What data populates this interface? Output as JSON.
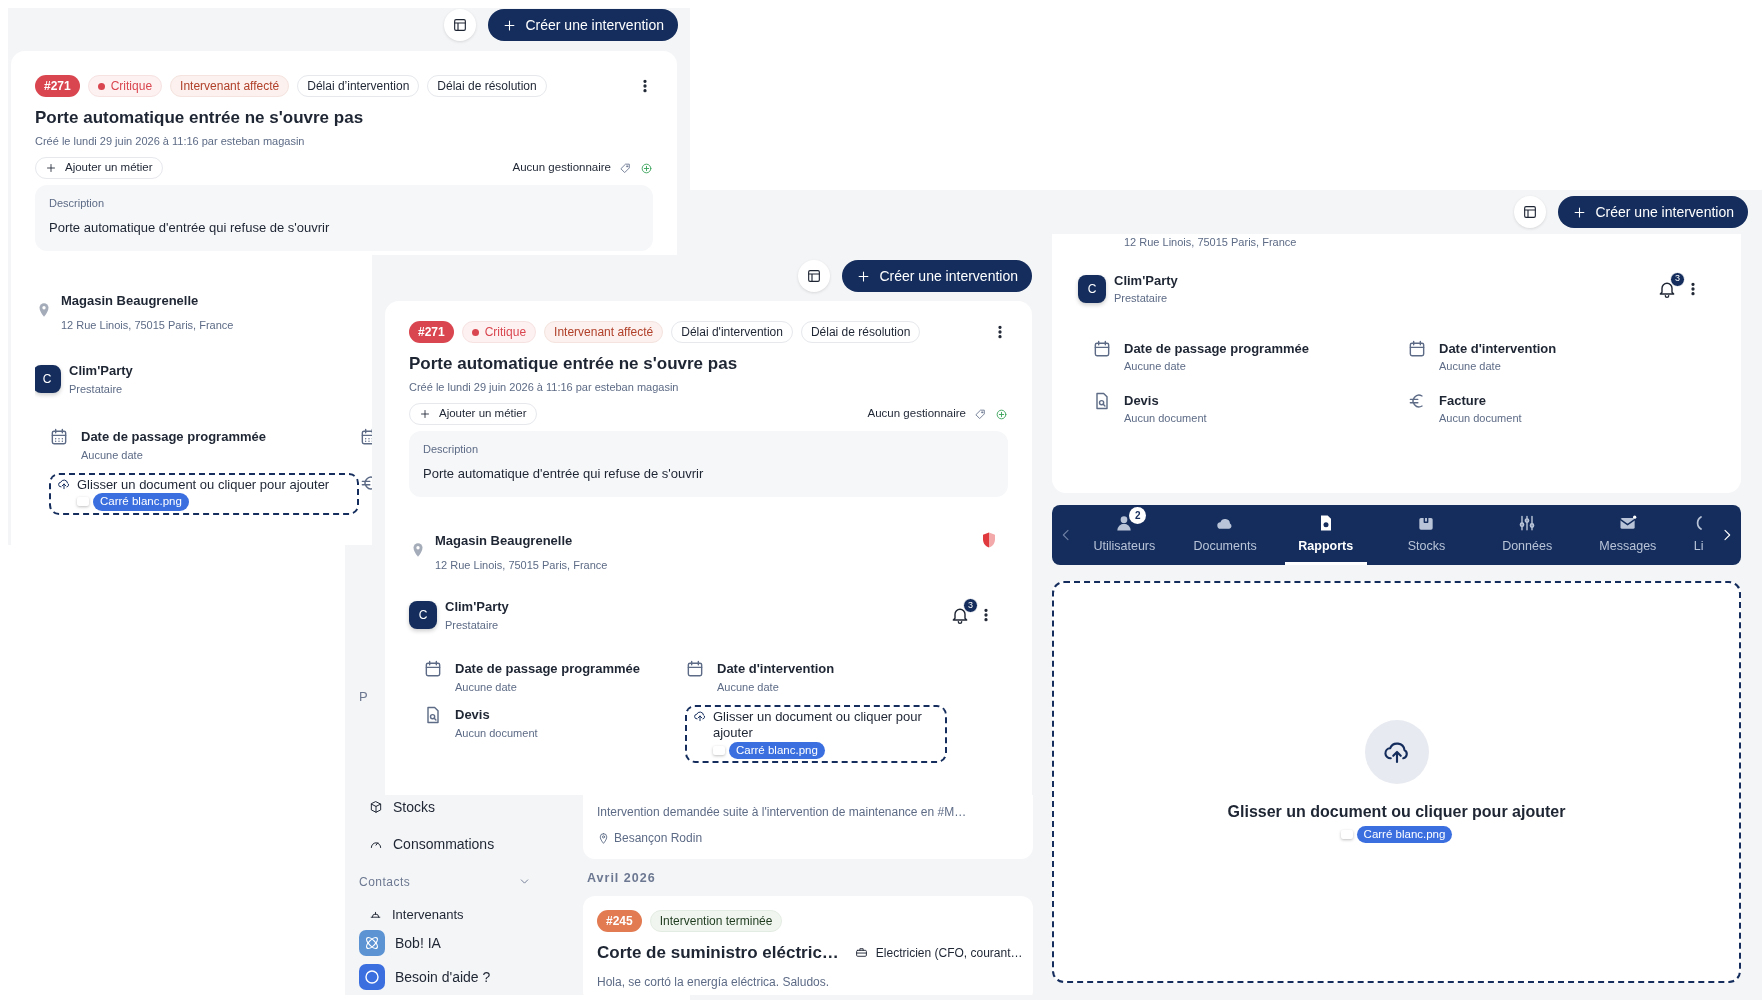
{
  "back_detail_screen": {
    "create_button": "Créer une intervention",
    "badges": [
      {
        "kind": "number",
        "text": "#271",
        "color": "#d9464f"
      },
      {
        "kind": "priority",
        "text": "Critique"
      },
      {
        "kind": "status",
        "text": "Intervenant affecté"
      },
      {
        "kind": "plain",
        "text": "Délai d’intervention"
      },
      {
        "kind": "plain",
        "text": "Délai de résolution"
      }
    ],
    "title": "Porte automatique entrée ne s'ouvre pas",
    "created": "Créé le lundi 29 juin 2026 à 11:16 par esteban magasin",
    "add_trade_button": "Ajouter un métier",
    "manager": "Aucun gestionnaire",
    "description_label": "Description",
    "description": "Porte automatique d'entrée qui refuse de s'ouvrir",
    "site": {
      "name": "Magasin Beaugrenelle",
      "address": "12 Rue Linois, 75015 Paris, France"
    },
    "provider": {
      "initial": "C",
      "name": "Clim'Party",
      "role": "Prestataire"
    },
    "fields": [
      {
        "kind": "date",
        "label": "Date de passage programmée",
        "value": "Aucune date"
      },
      {
        "kind": "date"
      },
      {
        "kind": "dropzone",
        "text": "Glisser un document ou cliquer pour ajouter",
        "dragged_file": "Carré blanc.png"
      },
      {
        "kind": "invoice"
      }
    ]
  },
  "front_detail_screen": {
    "create_button": "Créer une intervention",
    "badges": [
      {
        "kind": "number",
        "text": "#271",
        "color": "#d9464f"
      },
      {
        "kind": "priority",
        "text": "Critique"
      },
      {
        "kind": "status",
        "text": "Intervenant affecté"
      },
      {
        "kind": "plain",
        "text": "Délai d'intervention"
      },
      {
        "kind": "plain",
        "text": "Délai de résolution"
      }
    ],
    "title": "Porte automatique entrée ne s'ouvre pas",
    "created": "Créé le lundi 29 juin 2026 à 11:16 par esteban magasin",
    "add_trade_button": "Ajouter un métier",
    "manager": "Aucun gestionnaire",
    "description_label": "Description",
    "description": "Porte automatique d'entrée qui refuse de s'ouvrir",
    "site": {
      "name": "Magasin Beaugrenelle",
      "address": "12 Rue Linois, 75015 Paris, France"
    },
    "provider": {
      "initial": "C",
      "name": "Clim'Party",
      "role": "Prestataire",
      "notifications": "3"
    },
    "fields": [
      {
        "kind": "date",
        "label": "Date de passage programmée",
        "value": "Aucune date"
      },
      {
        "kind": "date",
        "label": "Date d'intervention",
        "value": "Aucune date"
      },
      {
        "kind": "quote",
        "label": "Devis",
        "value": "Aucun document"
      },
      {
        "kind": "dropzone",
        "text": "Glisser un document ou cliquer pour ajouter",
        "dragged_file": "Carré blanc.png"
      }
    ]
  },
  "list_screen": {
    "sidebar": {
      "cut_item": "P",
      "items": [
        {
          "label": "Stocks"
        },
        {
          "label": "Consommations"
        }
      ],
      "section": {
        "label": "Contacts",
        "expanded": true,
        "items": [
          {
            "label": "Intervenants"
          }
        ]
      },
      "footer": [
        {
          "label": "Bob! IA"
        },
        {
          "label": "Besoin d'aide ?"
        }
      ]
    },
    "previous_card": {
      "description": "Intervention demandée suite à l'intervention de maintenance en #M…",
      "location": "Besançon Rodin"
    },
    "month": "Avril 2026",
    "cards": [
      {
        "number": "#245",
        "color": "#e27a52",
        "status": "Intervention terminée",
        "title": "Corte de suministro eléctric…",
        "trade": "Electricien (CFO, courant…",
        "description": "Hola, se cortó la energía eléctrica. Saludos."
      }
    ]
  },
  "right_detail_screen": {
    "create_button": "Créer une intervention",
    "address": "12 Rue Linois, 75015 Paris, France",
    "provider": {
      "initial": "C",
      "name": "Clim'Party",
      "role": "Prestataire",
      "notifications": "3"
    },
    "fields": [
      {
        "kind": "date",
        "label": "Date de passage programmée",
        "value": "Aucune date"
      },
      {
        "kind": "date",
        "label": "Date d'intervention",
        "value": "Aucune date"
      },
      {
        "kind": "quote",
        "label": "Devis",
        "value": "Aucun document"
      },
      {
        "kind": "invoice",
        "label": "Facture",
        "value": "Aucun document"
      }
    ],
    "tabs": [
      {
        "label": "Utilisateurs",
        "selected": false,
        "count": "2"
      },
      {
        "label": "Documents",
        "selected": false
      },
      {
        "label": "Rapports",
        "selected": true
      },
      {
        "label": "Stocks",
        "selected": false
      },
      {
        "label": "Données",
        "selected": false
      },
      {
        "label": "Messages",
        "selected": false
      },
      {
        "label": "Li",
        "selected": false
      }
    ],
    "dropzone": {
      "text": "Glisser un document ou cliquer pour ajouter",
      "dragged_file": "Carré blanc.png"
    }
  }
}
